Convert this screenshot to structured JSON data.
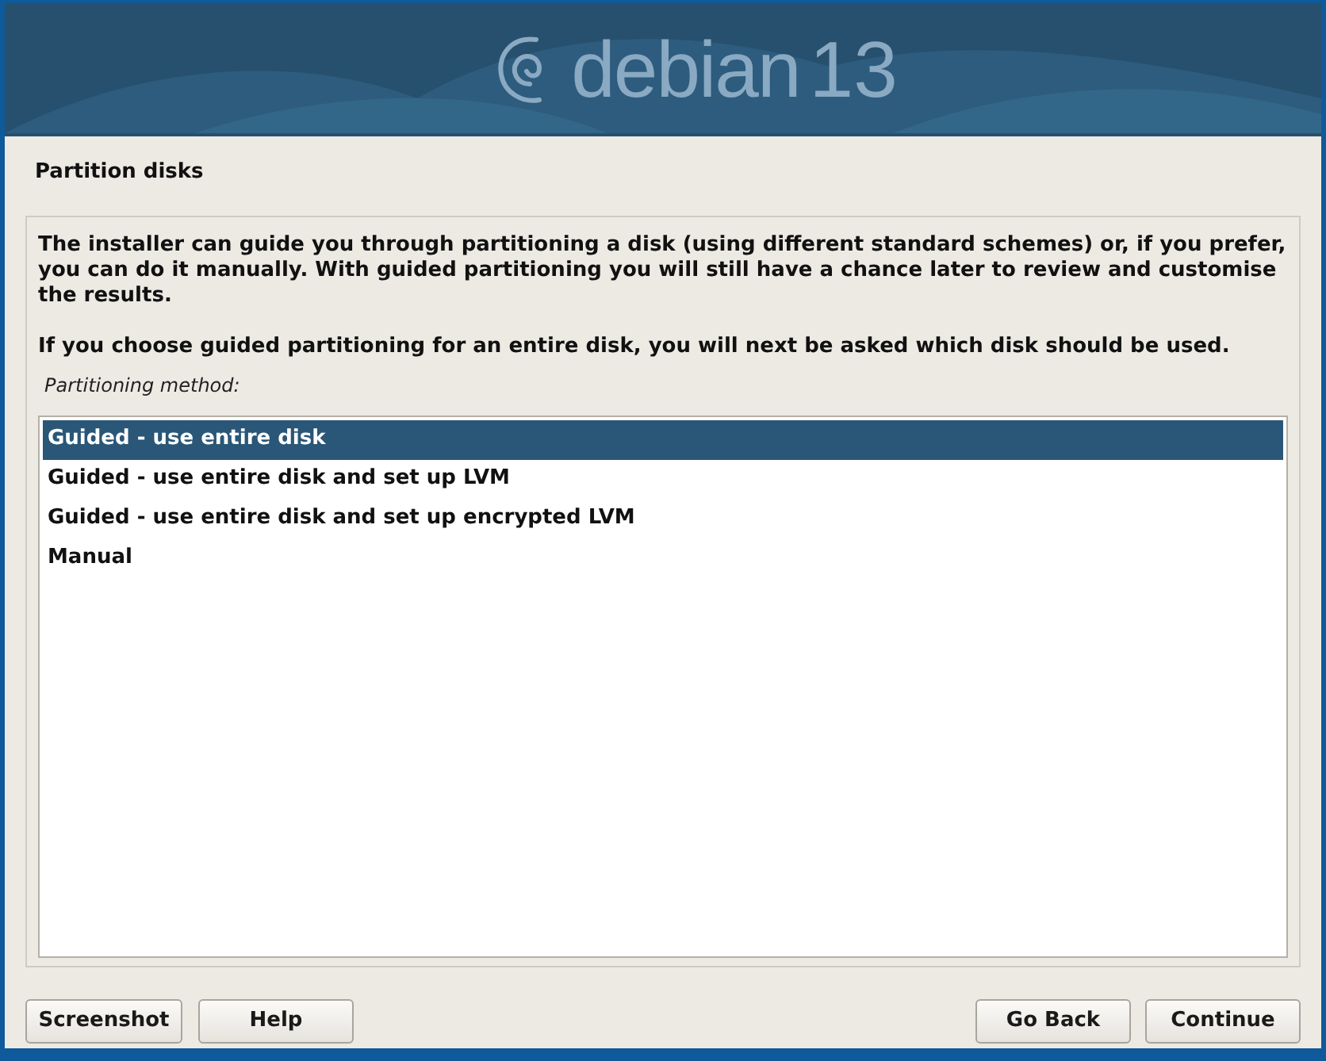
{
  "banner": {
    "logo_text": "debian",
    "version": "13"
  },
  "title": "Partition disks",
  "paragraphs": [
    "The installer can guide you through partitioning a disk (using different standard schemes) or, if you prefer, you can do it manually. With guided partitioning you will still have a chance later to review and customise the results.",
    "If you choose guided partitioning for an entire disk, you will next be asked which disk should be used."
  ],
  "list_label": "Partitioning method:",
  "options": [
    {
      "label": "Guided - use entire disk",
      "selected": true
    },
    {
      "label": "Guided - use entire disk and set up LVM",
      "selected": false
    },
    {
      "label": "Guided - use entire disk and set up encrypted LVM",
      "selected": false
    },
    {
      "label": "Manual",
      "selected": false
    }
  ],
  "buttons_left": [
    "Screenshot",
    "Help"
  ],
  "buttons_right": [
    "Go Back",
    "Continue"
  ]
}
